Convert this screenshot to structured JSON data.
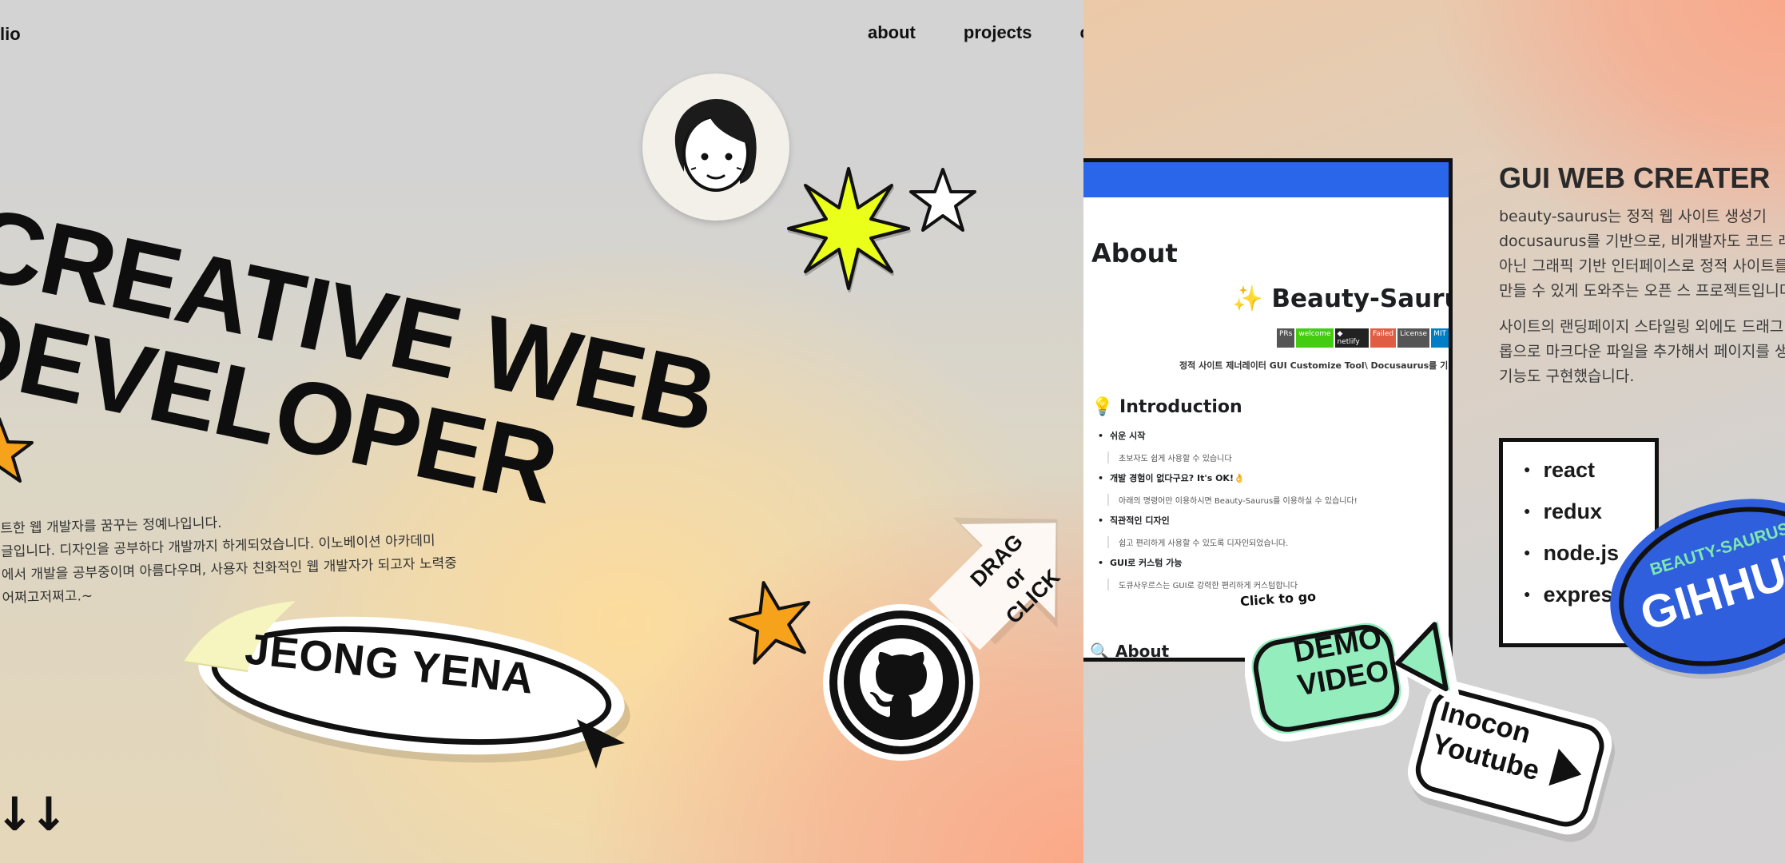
{
  "header": {
    "logo_fragment": "lio",
    "nav": [
      "about",
      "projects",
      "c"
    ]
  },
  "hero": {
    "title_line1": "CREATIVE WEB",
    "title_line2": "DEVELOPER",
    "intro_lines": [
      "트한 웹 개발자를 꿈꾸는 정예나입니다.",
      "글입니다. 디자인을 공부하다 개발까지 하게되었습니다. 이노베이션 아카데미",
      "에서 개발을 공부중이며 아름다우며, 사용자 친화적인 웹 개발자가 되고자 노력중",
      "어쩌고저쩌고.~"
    ],
    "name_sticker": "JEONG YENA",
    "drag_sticker": [
      "DRAG",
      "or",
      "CLICK"
    ],
    "scroll_arrows": "↓↓"
  },
  "project": {
    "screenshot": {
      "about": "About",
      "title": "✨ Beauty-Saurus",
      "badges": [
        {
          "text": "PRs",
          "color": "#555555"
        },
        {
          "text": "welcome",
          "color": "#4c1"
        },
        {
          "text": "◆ netlify",
          "color": "#222222"
        },
        {
          "text": "Failed",
          "color": "#e05d44"
        },
        {
          "text": "License",
          "color": "#555555"
        },
        {
          "text": "MIT",
          "color": "#007ec6"
        }
      ],
      "description": "정적 사이트 제너레이터 GUI Customize Tool\\ Docusaurus를 기반으로 한",
      "intro_heading": "💡 Introduction",
      "items": [
        {
          "bold": "쉬운 시작",
          "quote": "초보자도 쉽게 사용할 수 있습니다"
        },
        {
          "bold": "개발 경험이 없다구요? It's OK!👌",
          "quote": "아래의 명령어만 이용하시면 Beauty-Saurus를 이용하실 수 있습니다!"
        },
        {
          "bold": "직관적인 디자인",
          "quote": "쉽고 편리하게 사용할 수 있도록 디자인되었습니다."
        },
        {
          "bold": "GUI로 커스텀 가능",
          "quote": "도큐사우르스는 GUI로 강력한 편리하게 커스텀합니다"
        }
      ],
      "about_bottom": "🔍 About",
      "click_to_go": "Click to go"
    },
    "title": "GUI WEB CREATER",
    "description": [
      "beauty-saurus는 정적 웹 사이트 생성기 docusaurus를 기반으로, 비개발자도 코드 레벨이 아닌 그래픽 기반 인터페이스로 정적 사이트를 쉽게 만들 수 있게 도와주는 오픈 스 프로젝트입니다.",
      "사이트의 랜딩페이지 스타일링 외에도 드래그 앤 드롭으로 마크다운 파일을 추가해서 페이지를 생성하는 기능도 구현했습니다."
    ],
    "stack": [
      "react",
      "redux",
      "node.js",
      "express"
    ],
    "demo_sticker": [
      "DEMO",
      "VIDEO"
    ],
    "youtube_sticker": [
      "Inocon",
      "Youtube"
    ],
    "github_sticker_small": "BEAUTY-SAURUS",
    "github_sticker_big": "GIHHUB"
  },
  "colors": {
    "peach": "#fca887",
    "yellow_star": "#eaff1a",
    "orange_star": "#f7a21b",
    "mint": "#93edbd",
    "blue": "#2f5fdc"
  }
}
